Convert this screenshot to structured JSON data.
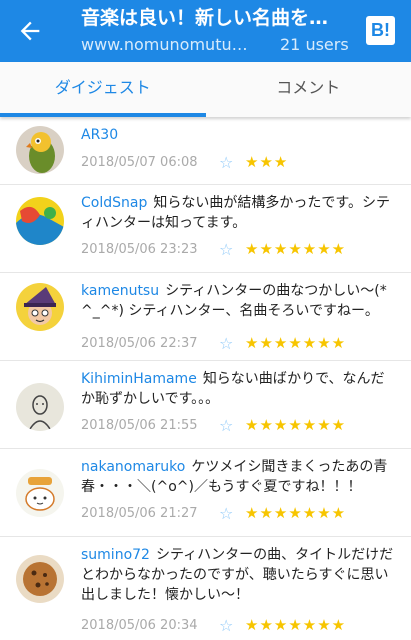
{
  "header": {
    "title": "音楽は良い！新しい名曲を…",
    "domain": "www.nomunomutuk…",
    "users": "21 users",
    "b_button": "B!",
    "colors": {
      "bar": "#1e88e5",
      "accent": "#1e88e5",
      "star": "#f7c500"
    }
  },
  "tabs": [
    {
      "label": "ダイジェスト",
      "active": true
    },
    {
      "label": "コメント",
      "active": false
    }
  ],
  "comments": [
    {
      "user": "AR30",
      "text": "",
      "date": "2018/05/07 06:08",
      "stars": "★★★",
      "avatar": "parrot"
    },
    {
      "user": "ColdSnap",
      "text": "知らない曲が結構多かったです。シティハンターは知ってます。",
      "date": "2018/05/06 23:23",
      "stars": "★★★★★★★",
      "avatar": "abstract"
    },
    {
      "user": "kamenutsu",
      "text": "シティハンターの曲なつかしい〜(*^_^*) シティハンター、名曲そろいですねー。",
      "date": "2018/05/06 22:37",
      "stars": "★★★★★★★",
      "avatar": "witch"
    },
    {
      "user": "KihiminHamame",
      "text": "知らない曲ばかりで、なんだか恥ずかしいです。。。",
      "date": "2018/05/06 21:55",
      "stars": "★★★★★★★",
      "avatar": "sketch"
    },
    {
      "user": "nakanomaruko",
      "text": "ケツメイシ聞きまくったあの青春・・・＼(^o^)／もうすぐ夏ですね！！！",
      "date": "2018/05/06 21:27",
      "stars": "★★★★★★★",
      "avatar": "maru"
    },
    {
      "user": "sumino72",
      "text": "シティハンターの曲、タイトルだけだとわからなかったのですが、聴いたらすぐに思い出しました！懐かしい〜！",
      "date": "2018/05/06 20:34",
      "stars": "★★★★★★★",
      "avatar": "cookie"
    }
  ]
}
